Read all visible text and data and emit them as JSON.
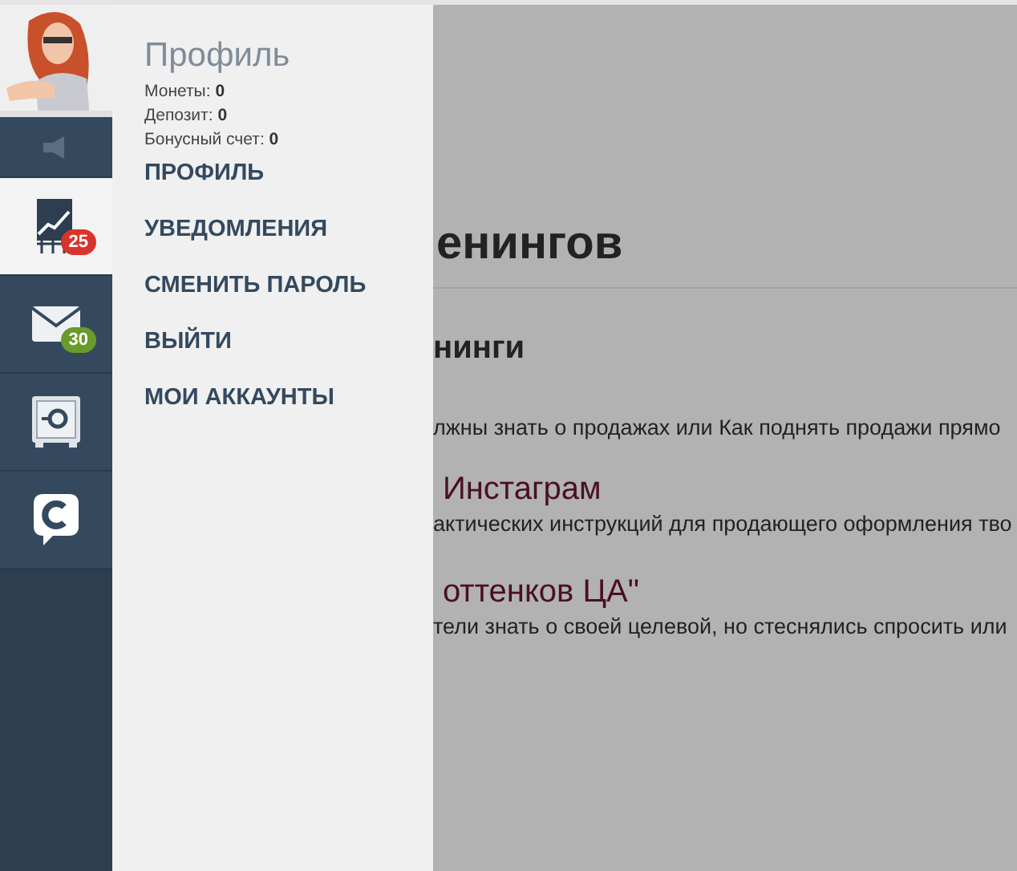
{
  "sidebar": [
    {
      "kind": "speaker",
      "selected": false
    },
    {
      "kind": "chart",
      "selected": true,
      "badge": "25",
      "color": "#d9342b"
    },
    {
      "kind": "mail",
      "selected": false,
      "badge": "30",
      "color": "#6a9a2a"
    },
    {
      "kind": "safe",
      "selected": false
    },
    {
      "kind": "chat",
      "selected": false
    }
  ],
  "profile": {
    "title": "Профиль",
    "stats": [
      {
        "label": "Монеты:",
        "value": "0"
      },
      {
        "label": "Депозит:",
        "value": "0"
      },
      {
        "label": "Бонусный счет:",
        "value": "0"
      }
    ]
  },
  "menu": [
    "ПРОФИЛЬ",
    "УВЕДОМЛЕНИЯ",
    "СМЕНИТЬ ПАРОЛЬ",
    "ВЫЙТИ",
    "МОИ АККАУНТЫ"
  ],
  "content": {
    "heading": "енингов",
    "subheading": "нинги",
    "intro": "лжны знать о продажах или Как поднять продажи прямо",
    "items": [
      {
        "title": "Инстаграм",
        "text": "актических инструкций для продающего оформления тво"
      },
      {
        "title": "оттенков ЦА\"",
        "text": "тели знать о своей целевой, но стеснялись спросить или"
      }
    ]
  }
}
